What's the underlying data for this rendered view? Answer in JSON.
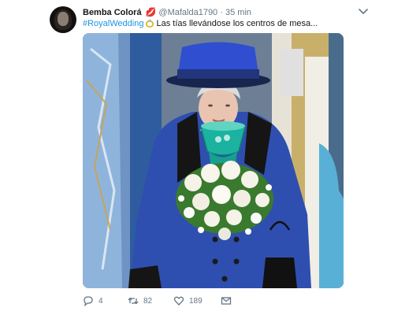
{
  "tweet": {
    "display_name": "Bemba Colorá",
    "name_emoji": "kiss-mark-icon",
    "handle": "@Mafalda1790",
    "separator": "·",
    "time": "35 min",
    "hashtag": "#RoyalWedding",
    "hashtag_emoji": "ring-icon",
    "text": "Las tías llevándose los centros de mesa...",
    "media_icon": "photo-queen-blue-outfit-holding-bouquet"
  },
  "actions": {
    "reply_count": "4",
    "retweet_count": "82",
    "like_count": "189"
  },
  "colors": {
    "link": "#1b95e0",
    "secondary": "#657786",
    "text": "#14171a",
    "coat_blue": "#2f4fb0"
  }
}
